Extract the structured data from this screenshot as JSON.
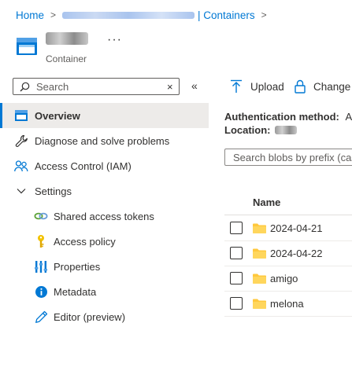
{
  "breadcrumb": {
    "home": "Home",
    "separator": ">",
    "containers": "| Containers",
    "trailing_separator": ">"
  },
  "resource": {
    "type": "Container",
    "more": "···"
  },
  "search": {
    "placeholder": "Search",
    "clear_icon": "×",
    "collapse_icon": "«"
  },
  "nav": {
    "overview": "Overview",
    "diagnose": "Diagnose and solve problems",
    "access_control": "Access Control (IAM)",
    "settings": "Settings",
    "shared_access_tokens": "Shared access tokens",
    "access_policy": "Access policy",
    "properties": "Properties",
    "metadata": "Metadata",
    "editor": "Editor (preview)"
  },
  "toolbar": {
    "upload": "Upload",
    "change": "Change a"
  },
  "info": {
    "auth_label": "Authentication method:",
    "auth_value": "Ac",
    "location_label": "Location:"
  },
  "blobs": {
    "search_placeholder": "Search blobs by prefix (case-sensitive)",
    "column_name": "Name",
    "rows": [
      "2024-04-21",
      "2024-04-22",
      "amigo",
      "melona"
    ]
  },
  "colors": {
    "accent": "#0078d4",
    "folder": "#ffc83d",
    "active_bg": "#edebe9"
  }
}
